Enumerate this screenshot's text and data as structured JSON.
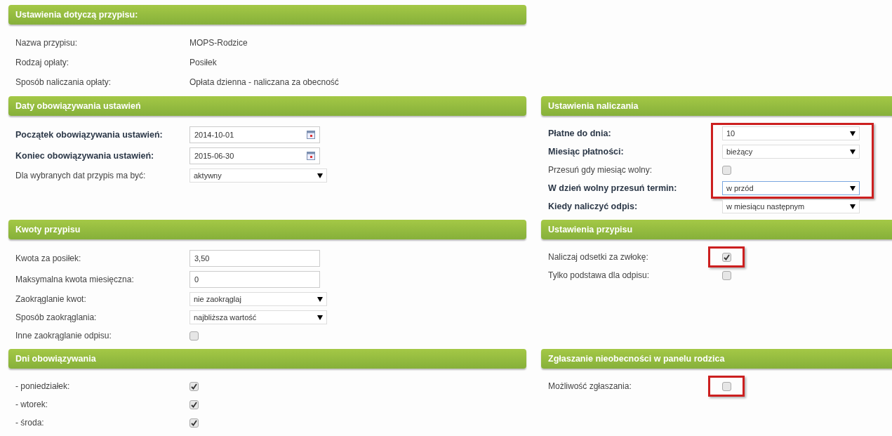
{
  "rows": [
    {
      "left": {
        "title": "Ustawienia dotyczą przypisu:",
        "fields": [
          {
            "kind": "text",
            "label": "Nazwa przypisu:",
            "bold": false,
            "value": "MOPS-Rodzice"
          },
          {
            "kind": "text",
            "label": "Rodzaj opłaty:",
            "bold": false,
            "value": "Posiłek"
          },
          {
            "kind": "text",
            "label": "Sposób naliczania opłaty:",
            "bold": false,
            "value": "Opłata dzienna - naliczana za obecność"
          }
        ]
      }
    },
    {
      "left": {
        "title": "Daty obowiązywania ustawień",
        "fields": [
          {
            "kind": "date",
            "label": "Początek obowiązywania ustawień:",
            "bold": true,
            "value": "2014-10-01"
          },
          {
            "kind": "date",
            "label": "Koniec obowiązywania ustawień:",
            "bold": true,
            "value": "2015-06-30"
          },
          {
            "kind": "select",
            "label": "Dla wybranych dat przypis ma być:",
            "bold": false,
            "value": "aktywny"
          }
        ]
      },
      "right": {
        "title": "Ustawienia naliczania",
        "fields": [
          {
            "kind": "select",
            "label": "Płatne do dnia:",
            "bold": true,
            "value": "10",
            "highlighted": true
          },
          {
            "kind": "select",
            "label": "Miesiąc płatności:",
            "bold": true,
            "value": "bieżący",
            "highlighted": true
          },
          {
            "kind": "checkbox",
            "label": "Przesuń gdy miesiąc wolny:",
            "bold": false,
            "checked": false,
            "highlighted": true
          },
          {
            "kind": "select",
            "label": "W dzień wolny przesuń termin:",
            "bold": true,
            "value": "w przód",
            "highlighted": true,
            "focused": true
          },
          {
            "kind": "select",
            "label": "Kiedy naliczyć odpis:",
            "bold": true,
            "value": "w miesiącu następnym"
          }
        ]
      }
    },
    {
      "left": {
        "title": "Kwoty przypisu",
        "fields": [
          {
            "kind": "input",
            "label": "Kwota za posiłek:",
            "bold": false,
            "value": "3,50"
          },
          {
            "kind": "input",
            "label": "Maksymalna kwota miesięczna:",
            "bold": false,
            "value": "0"
          },
          {
            "kind": "select",
            "label": "Zaokrąglanie kwot:",
            "bold": false,
            "value": "nie zaokrąglaj"
          },
          {
            "kind": "select",
            "label": "Sposób zaokrąglania:",
            "bold": false,
            "value": "najbliższa wartość"
          },
          {
            "kind": "checkbox",
            "label": "Inne zaokrąglanie odpisu:",
            "bold": false,
            "checked": false
          }
        ]
      },
      "right": {
        "title": "Ustawienia przypisu",
        "fields": [
          {
            "kind": "checkbox",
            "label": "Naliczaj odsetki za zwłokę:",
            "bold": false,
            "checked": true,
            "highlighted": true
          },
          {
            "kind": "checkbox",
            "label": "Tylko podstawa dla odpisu:",
            "bold": false,
            "checked": false
          }
        ]
      }
    },
    {
      "left": {
        "title": "Dni obowiązywania",
        "fields": [
          {
            "kind": "checkbox",
            "label": "- poniedziałek:",
            "bold": false,
            "checked": true
          },
          {
            "kind": "checkbox",
            "label": "- wtorek:",
            "bold": false,
            "checked": true
          },
          {
            "kind": "checkbox",
            "label": "- środa:",
            "bold": false,
            "checked": true
          }
        ]
      },
      "right": {
        "title": "Zgłaszanie nieobecności w panelu rodzica",
        "fields": [
          {
            "kind": "checkbox",
            "label": "Możliwość zgłaszania:",
            "bold": false,
            "checked": false,
            "highlighted": true
          }
        ]
      }
    }
  ]
}
